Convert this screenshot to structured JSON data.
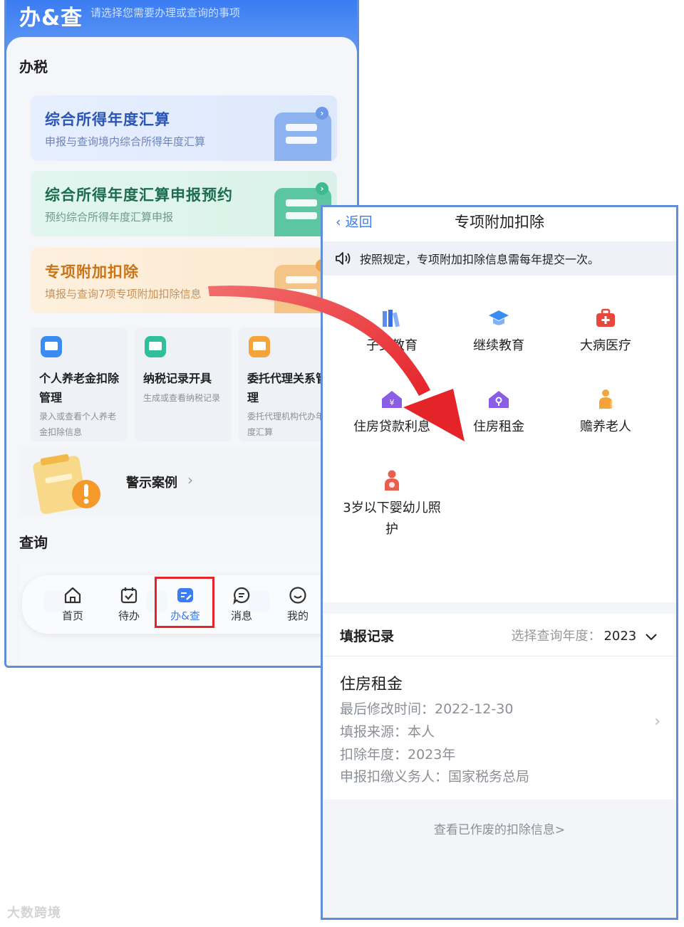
{
  "left": {
    "app_title": "办&查",
    "app_hint": "请选择您需要办理或查询的事项",
    "tax_section": "办税",
    "cards": [
      {
        "title": "综合所得年度汇算",
        "subtitle": "申报与查询境内综合所得年度汇算"
      },
      {
        "title": "综合所得年度汇算申报预约",
        "subtitle": "预约综合所得年度汇算申报"
      },
      {
        "title": "专项附加扣除",
        "subtitle": "填报与查询7项专项附加扣除信息"
      }
    ],
    "small_cards": [
      {
        "title": "个人养老金扣除管理",
        "desc": "录入或查看个人养老金扣除信息"
      },
      {
        "title": "纳税记录开具",
        "desc": "生成或查看纳税记录"
      },
      {
        "title": "委托代理关系管理",
        "desc": "委托代理机构代办年度汇算"
      }
    ],
    "warning": "警示案例",
    "query_section": "查询",
    "tabs": [
      "首页",
      "待办",
      "办&查",
      "消息",
      "我的"
    ],
    "colors": {
      "brand": "#3a7cf1",
      "highlight": "#e5242a"
    }
  },
  "right": {
    "back": "返回",
    "title": "专项附加扣除",
    "notice": "按照规定，专项附加扣除信息需每年提交一次。",
    "items": [
      {
        "label": "子女教育",
        "icon": "books-icon"
      },
      {
        "label": "继续教育",
        "icon": "graduation-cap-icon"
      },
      {
        "label": "大病医疗",
        "icon": "medical-kit-icon"
      },
      {
        "label": "住房贷款利息",
        "icon": "house-yuan-icon"
      },
      {
        "label": "住房租金",
        "icon": "house-key-icon"
      },
      {
        "label": "赡养老人",
        "icon": "elderly-person-icon"
      },
      {
        "label": "3岁以下婴幼儿照护",
        "icon": "mother-baby-icon"
      }
    ],
    "records_title": "填报记录",
    "year_label": "选择查询年度：",
    "year_value": "2023",
    "record": {
      "title": "住房租金",
      "modified": "最后修改时间：2022-12-30",
      "source": "填报来源：本人",
      "year": "扣除年度：2023年",
      "agent": "申报扣缴义务人：国家税务总局"
    },
    "void_link": "查看已作废的扣除信息>"
  },
  "watermark": "大数跨境"
}
